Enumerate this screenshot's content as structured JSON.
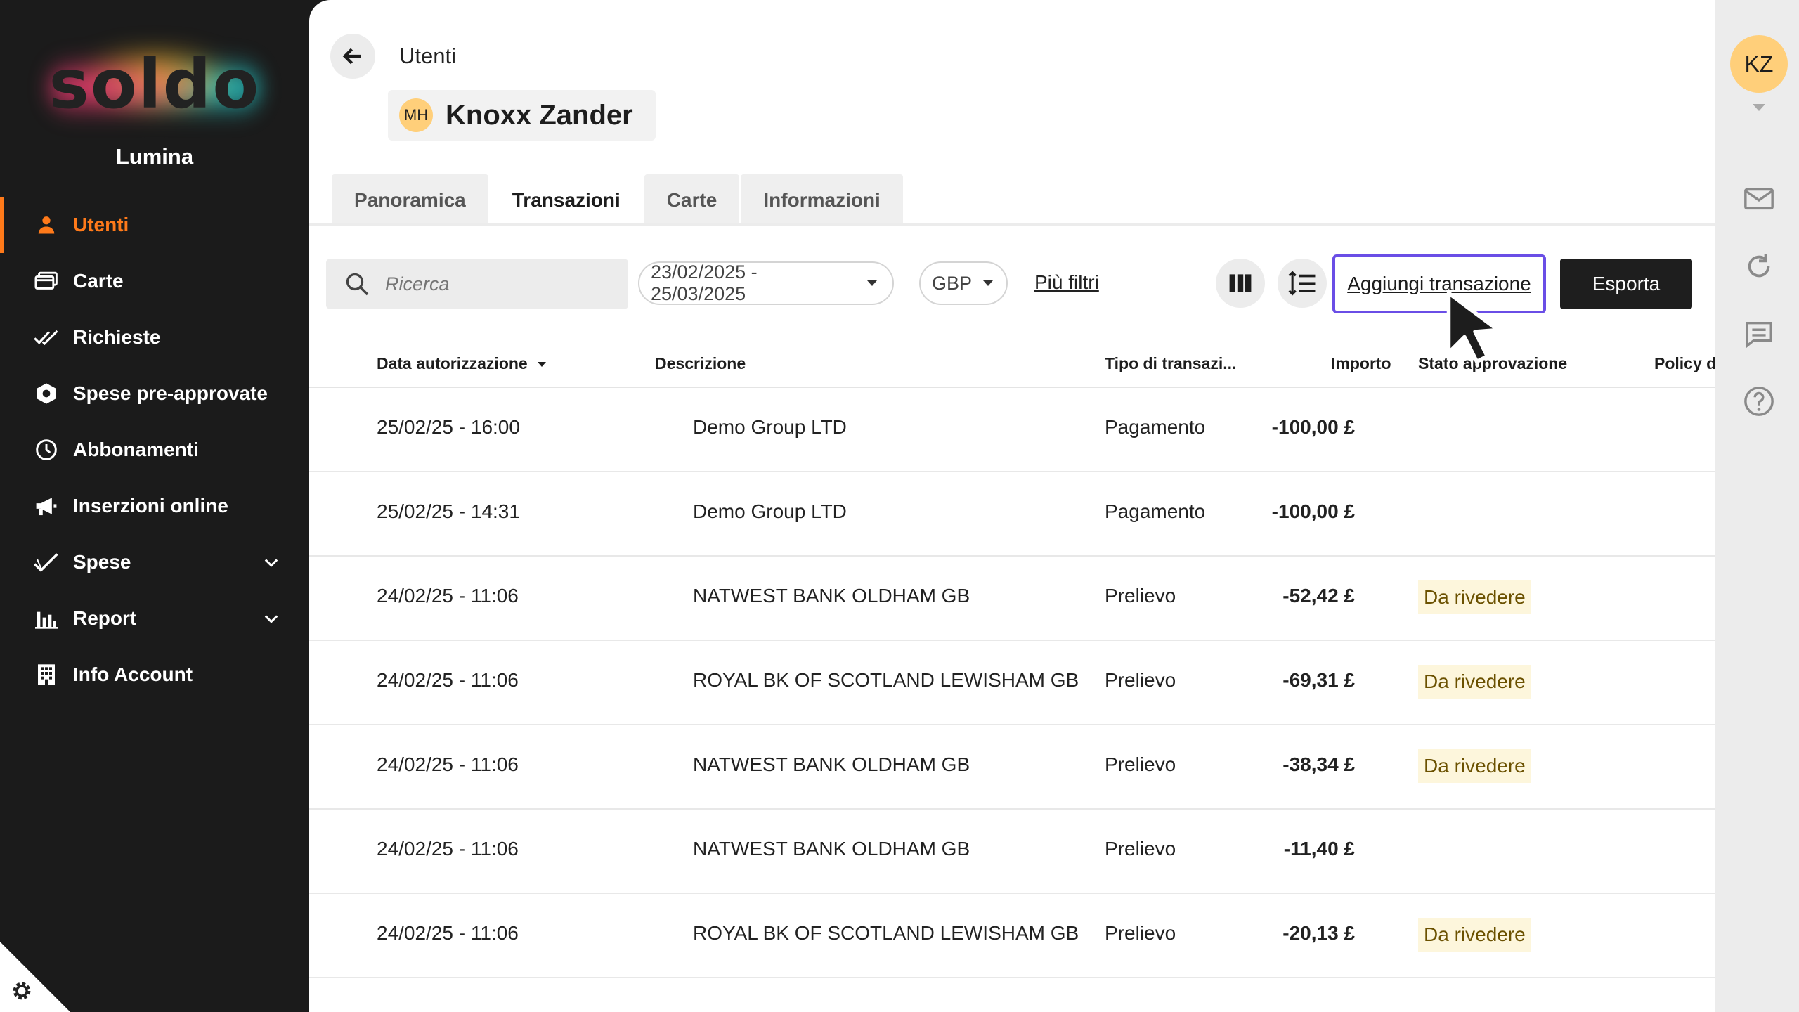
{
  "sidebar": {
    "logo_text": "soldo",
    "org_name": "Lumina",
    "items": [
      {
        "label": "Utenti",
        "icon": "person-icon"
      },
      {
        "label": "Carte",
        "icon": "cards-icon"
      },
      {
        "label": "Richieste",
        "icon": "double-check-icon"
      },
      {
        "label": "Spese pre-approvate",
        "icon": "hexagon-icon"
      },
      {
        "label": "Abbonamenti",
        "icon": "clock-icon"
      },
      {
        "label": "Inserzioni online",
        "icon": "megaphone-icon"
      },
      {
        "label": "Spese",
        "icon": "check-icon"
      },
      {
        "label": "Report",
        "icon": "bar-chart-icon"
      },
      {
        "label": "Info Account",
        "icon": "building-icon"
      }
    ],
    "active_item": "Utenti",
    "accent_color": "#ff7a1a"
  },
  "header": {
    "breadcrumb": "Utenti",
    "user_initials": "MH",
    "user_name": "Knoxx Zander"
  },
  "tabs": [
    {
      "label": "Panoramica"
    },
    {
      "label": "Transazioni"
    },
    {
      "label": "Carte"
    },
    {
      "label": "Informazioni"
    }
  ],
  "active_tab": "Transazioni",
  "toolbar": {
    "search_placeholder": "Ricerca",
    "date_range": "23/02/2025 - 25/03/2025",
    "currency": "GBP",
    "more_filters": "Più filtri",
    "add_transaction": "Aggiungi transazione",
    "export": "Esporta",
    "add_button_border_color": "#6a4ee6"
  },
  "table": {
    "columns": [
      "Data autorizzazione",
      "Descrizione",
      "Tipo di transazi...",
      "Importo",
      "Stato approvazione",
      "Policy d"
    ],
    "rows": [
      {
        "date": "25/02/25 - 16:00",
        "description": "Demo Group LTD",
        "type": "Pagamento",
        "amount": "-100,00 £",
        "status": ""
      },
      {
        "date": "25/02/25 - 14:31",
        "description": "Demo Group LTD",
        "type": "Pagamento",
        "amount": "-100,00 £",
        "status": ""
      },
      {
        "date": "24/02/25 - 11:06",
        "description": "NATWEST BANK OLDHAM GB",
        "type": "Prelievo",
        "amount": "-52,42 £",
        "status": "Da rivedere"
      },
      {
        "date": "24/02/25 - 11:06",
        "description": "ROYAL BK OF SCOTLAND LEWISHAM GB",
        "type": "Prelievo",
        "amount": "-69,31 £",
        "status": "Da rivedere"
      },
      {
        "date": "24/02/25 - 11:06",
        "description": "NATWEST BANK OLDHAM GB",
        "type": "Prelievo",
        "amount": "-38,34 £",
        "status": "Da rivedere"
      },
      {
        "date": "24/02/25 - 11:06",
        "description": "NATWEST BANK OLDHAM GB",
        "type": "Prelievo",
        "amount": "-11,40 £",
        "status": ""
      },
      {
        "date": "24/02/25 - 11:06",
        "description": "ROYAL BK OF SCOTLAND LEWISHAM GB",
        "type": "Prelievo",
        "amount": "-20,13 £",
        "status": "Da rivedere"
      }
    ]
  },
  "rail": {
    "avatar_initials": "KZ",
    "icons": [
      "mail-icon",
      "refresh-icon",
      "chat-icon",
      "help-icon"
    ]
  }
}
